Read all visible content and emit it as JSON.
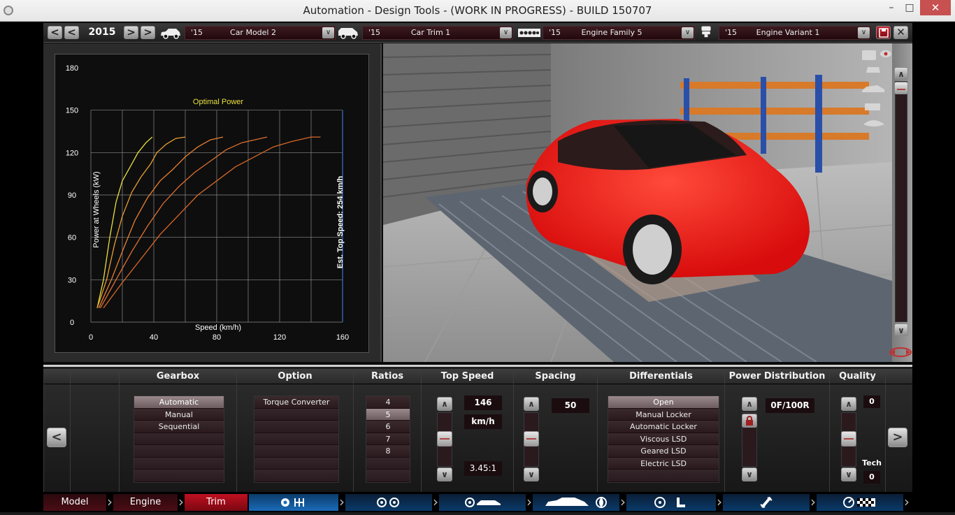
{
  "window": {
    "title": "Automation - Design Tools - (WORK IN PROGRESS) - BUILD 150707",
    "minimize": "–",
    "maximize": "□",
    "close": "✕"
  },
  "topbar": {
    "year": "2015",
    "prev2": "<",
    "prev": "<",
    "next": ">",
    "next2": ">",
    "selectors": [
      {
        "year": "'15",
        "name": "Car Model 2",
        "icon": "car-icon"
      },
      {
        "year": "'15",
        "name": "Car Trim 1",
        "icon": "van-icon"
      },
      {
        "year": "'15",
        "name": "Engine Family 5",
        "icon": "engine-block-icon"
      },
      {
        "year": "'15",
        "name": "Engine Variant 1",
        "icon": "piston-icon"
      }
    ],
    "dropdown_glyph": "∨",
    "save_icon": "save-icon",
    "close_glyph": "✕"
  },
  "chart_data": {
    "type": "line",
    "title": "Optimal Power",
    "xlabel": "Speed (km/h)",
    "ylabel": "Power at Wheels (kW)",
    "annotation": "Est. Top Speed: 254 km/h",
    "xlim": [
      0,
      160
    ],
    "ylim": [
      0,
      180
    ],
    "xticks": [
      0,
      40,
      80,
      120,
      160
    ],
    "yticks": [
      0,
      30,
      60,
      90,
      120,
      150,
      180
    ],
    "grid": true,
    "series": [
      {
        "color": "#e8e040",
        "points": [
          [
            4,
            10
          ],
          [
            8,
            30
          ],
          [
            12,
            60
          ],
          [
            16,
            85
          ],
          [
            20,
            100
          ],
          [
            25,
            110
          ],
          [
            30,
            120
          ],
          [
            35,
            127
          ],
          [
            39,
            131
          ]
        ]
      },
      {
        "color": "#e8a030",
        "points": [
          [
            4,
            10
          ],
          [
            10,
            30
          ],
          [
            15,
            55
          ],
          [
            20,
            75
          ],
          [
            26,
            92
          ],
          [
            32,
            103
          ],
          [
            38,
            112
          ],
          [
            42,
            120
          ],
          [
            48,
            126
          ],
          [
            54,
            130
          ],
          [
            60,
            131
          ]
        ]
      },
      {
        "color": "#e88030",
        "points": [
          [
            5,
            10
          ],
          [
            13,
            30
          ],
          [
            20,
            50
          ],
          [
            28,
            72
          ],
          [
            36,
            88
          ],
          [
            44,
            100
          ],
          [
            52,
            108
          ],
          [
            60,
            117
          ],
          [
            68,
            124
          ],
          [
            76,
            129
          ],
          [
            84,
            131
          ]
        ]
      },
      {
        "color": "#e07030",
        "points": [
          [
            6,
            10
          ],
          [
            16,
            30
          ],
          [
            26,
            50
          ],
          [
            36,
            68
          ],
          [
            46,
            84
          ],
          [
            56,
            96
          ],
          [
            66,
            106
          ],
          [
            76,
            114
          ],
          [
            86,
            122
          ],
          [
            96,
            127
          ],
          [
            112,
            131
          ]
        ]
      },
      {
        "color": "#d86828",
        "points": [
          [
            8,
            10
          ],
          [
            20,
            28
          ],
          [
            32,
            45
          ],
          [
            44,
            62
          ],
          [
            56,
            76
          ],
          [
            68,
            90
          ],
          [
            80,
            100
          ],
          [
            92,
            110
          ],
          [
            104,
            117
          ],
          [
            116,
            124
          ],
          [
            128,
            128
          ],
          [
            140,
            131
          ],
          [
            146,
            131
          ]
        ]
      }
    ]
  },
  "bottom": {
    "nav_left": "<",
    "nav_right": ">",
    "headers": {
      "gearbox": "Gearbox",
      "option": "Option",
      "ratios": "Ratios",
      "top_speed": "Top Speed",
      "spacing": "Spacing",
      "differentials": "Differentials",
      "power_distribution": "Power Distribution",
      "quality": "Quality"
    },
    "gearbox_items": [
      "Automatic",
      "Manual",
      "Sequential"
    ],
    "option_items": [
      "Torque Converter"
    ],
    "ratio_items": [
      "4",
      "5",
      "6",
      "7",
      "8"
    ],
    "top_speed": {
      "value": "146",
      "unit": "km/h",
      "final_drive": "3.45:1"
    },
    "spacing": {
      "value": "50"
    },
    "differential_items": [
      "Open",
      "Manual Locker",
      "Automatic Locker",
      "Viscous LSD",
      "Geared LSD",
      "Electric LSD"
    ],
    "power_distribution": {
      "value": "0F/100R"
    },
    "quality": {
      "value": "0",
      "tech_label": "Tech",
      "tech_value": "0"
    },
    "up_glyph": "∧",
    "down_glyph": "∨"
  },
  "tabs": {
    "model": "Model",
    "engine": "Engine",
    "trim": "Trim"
  }
}
